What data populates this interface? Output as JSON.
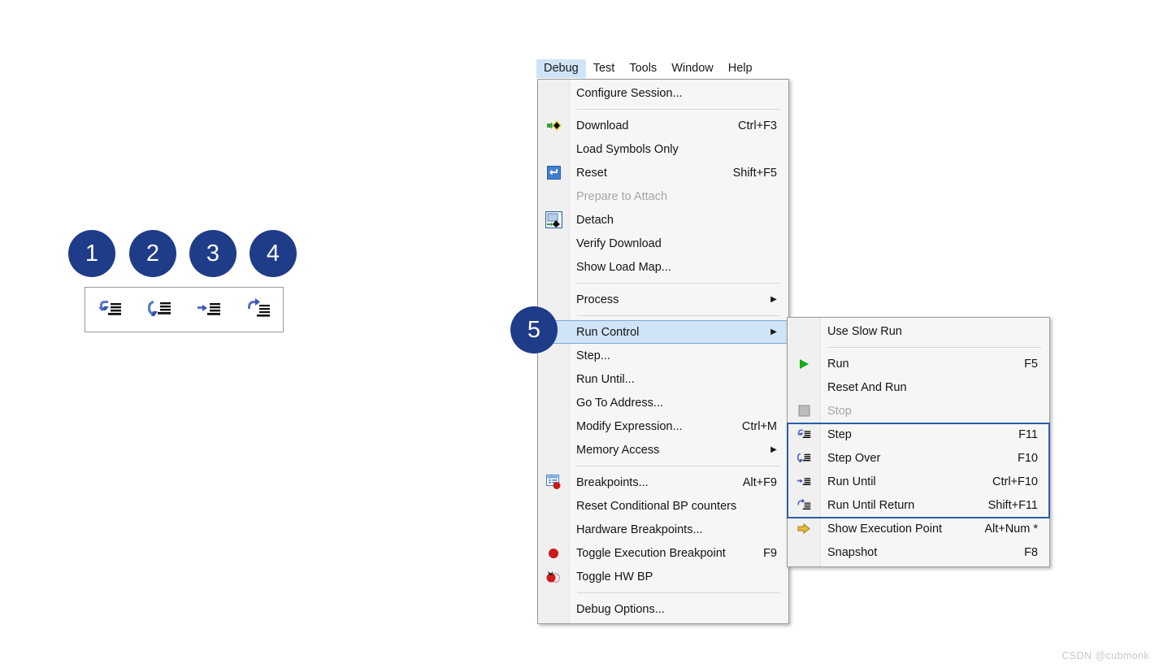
{
  "menubar": {
    "items": [
      {
        "label": "Debug",
        "active": true
      },
      {
        "label": "Test",
        "active": false
      },
      {
        "label": "Tools",
        "active": false
      },
      {
        "label": "Window",
        "active": false
      },
      {
        "label": "Help",
        "active": false
      }
    ]
  },
  "callouts": [
    {
      "number": "1"
    },
    {
      "number": "2"
    },
    {
      "number": "3"
    },
    {
      "number": "4"
    },
    {
      "number": "5"
    }
  ],
  "toolbar": {
    "icons": [
      {
        "name": "step-icon"
      },
      {
        "name": "step-over-icon"
      },
      {
        "name": "run-until-icon"
      },
      {
        "name": "run-until-return-icon"
      }
    ]
  },
  "debug_menu": {
    "items": [
      {
        "label": "Configure Session...",
        "accel": "",
        "icon": "",
        "arrow": false,
        "disabled": false,
        "highlighted": false,
        "sep_after": true
      },
      {
        "label": "Download",
        "accel": "Ctrl+F3",
        "icon": "download-icon",
        "arrow": false,
        "disabled": false,
        "highlighted": false,
        "sep_after": false
      },
      {
        "label": "Load Symbols Only",
        "accel": "",
        "icon": "",
        "arrow": false,
        "disabled": false,
        "highlighted": false,
        "sep_after": false
      },
      {
        "label": "Reset",
        "accel": "Shift+F5",
        "icon": "reset-icon",
        "arrow": false,
        "disabled": false,
        "highlighted": false,
        "sep_after": false
      },
      {
        "label": "Prepare to Attach",
        "accel": "",
        "icon": "",
        "arrow": false,
        "disabled": true,
        "highlighted": false,
        "sep_after": false
      },
      {
        "label": "Detach",
        "accel": "",
        "icon": "detach-icon",
        "arrow": false,
        "disabled": false,
        "highlighted": false,
        "sep_after": false
      },
      {
        "label": "Verify Download",
        "accel": "",
        "icon": "",
        "arrow": false,
        "disabled": false,
        "highlighted": false,
        "sep_after": false
      },
      {
        "label": "Show Load Map...",
        "accel": "",
        "icon": "",
        "arrow": false,
        "disabled": false,
        "highlighted": false,
        "sep_after": true
      },
      {
        "label": "Process",
        "accel": "",
        "icon": "",
        "arrow": true,
        "disabled": false,
        "highlighted": false,
        "sep_after": true
      },
      {
        "label": "Run Control",
        "accel": "",
        "icon": "",
        "arrow": true,
        "disabled": false,
        "highlighted": true,
        "sep_after": false
      },
      {
        "label": "Step...",
        "accel": "",
        "icon": "",
        "arrow": false,
        "disabled": false,
        "highlighted": false,
        "sep_after": false
      },
      {
        "label": "Run Until...",
        "accel": "",
        "icon": "",
        "arrow": false,
        "disabled": false,
        "highlighted": false,
        "sep_after": false
      },
      {
        "label": "Go To Address...",
        "accel": "",
        "icon": "",
        "arrow": false,
        "disabled": false,
        "highlighted": false,
        "sep_after": false
      },
      {
        "label": "Modify Expression...",
        "accel": "Ctrl+M",
        "icon": "",
        "arrow": false,
        "disabled": false,
        "highlighted": false,
        "sep_after": false
      },
      {
        "label": "Memory Access",
        "accel": "",
        "icon": "",
        "arrow": true,
        "disabled": false,
        "highlighted": false,
        "sep_after": true
      },
      {
        "label": "Breakpoints...",
        "accel": "Alt+F9",
        "icon": "breakpoints-icon",
        "arrow": false,
        "disabled": false,
        "highlighted": false,
        "sep_after": false
      },
      {
        "label": "Reset Conditional BP counters",
        "accel": "",
        "icon": "",
        "arrow": false,
        "disabled": false,
        "highlighted": false,
        "sep_after": false
      },
      {
        "label": "Hardware Breakpoints...",
        "accel": "",
        "icon": "",
        "arrow": false,
        "disabled": false,
        "highlighted": false,
        "sep_after": false
      },
      {
        "label": "Toggle Execution Breakpoint",
        "accel": "F9",
        "icon": "breakpoint-dot-icon",
        "arrow": false,
        "disabled": false,
        "highlighted": false,
        "sep_after": false
      },
      {
        "label": "Toggle HW BP",
        "accel": "",
        "icon": "hw-breakpoint-icon",
        "arrow": false,
        "disabled": false,
        "highlighted": false,
        "sep_after": true
      },
      {
        "label": "Debug Options...",
        "accel": "",
        "icon": "",
        "arrow": false,
        "disabled": false,
        "highlighted": false,
        "sep_after": false
      }
    ]
  },
  "run_control_menu": {
    "items": [
      {
        "label": "Use Slow Run",
        "accel": "",
        "icon": "",
        "disabled": false,
        "sep_after": true
      },
      {
        "label": "Run",
        "accel": "F5",
        "icon": "run-play-icon",
        "disabled": false,
        "sep_after": false
      },
      {
        "label": "Reset And Run",
        "accel": "",
        "icon": "",
        "disabled": false,
        "sep_after": false
      },
      {
        "label": "Stop",
        "accel": "",
        "icon": "stop-square-icon",
        "disabled": true,
        "sep_after": false
      },
      {
        "label": "Step",
        "accel": "F11",
        "icon": "step-icon",
        "disabled": false,
        "sep_after": false
      },
      {
        "label": "Step Over",
        "accel": "F10",
        "icon": "step-over-icon",
        "disabled": false,
        "sep_after": false
      },
      {
        "label": "Run Until",
        "accel": "Ctrl+F10",
        "icon": "run-until-icon",
        "disabled": false,
        "sep_after": false
      },
      {
        "label": "Run Until Return",
        "accel": "Shift+F11",
        "icon": "run-until-return-icon",
        "disabled": false,
        "sep_after": false
      },
      {
        "label": "Show Execution Point",
        "accel": "Alt+Num *",
        "icon": "show-execution-point-icon",
        "disabled": false,
        "sep_after": false
      },
      {
        "label": "Snapshot",
        "accel": "F8",
        "icon": "",
        "disabled": false,
        "sep_after": false
      }
    ]
  },
  "watermark": {
    "text": "CSDN @cubmonk"
  },
  "colors": {
    "callout_blue": "#1f3c88",
    "highlight_blue": "#cfe4f7",
    "group_border": "#2a5fa5",
    "menu_bg": "#f6f6f6"
  }
}
